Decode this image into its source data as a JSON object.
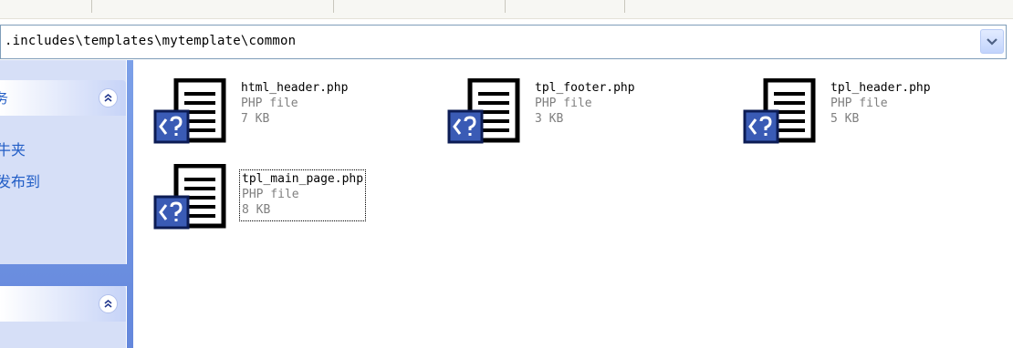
{
  "address_bar": {
    "path": ".includes\\templates\\mytemplate\\common"
  },
  "task_pane": {
    "panel1": {
      "title_fragment": "务",
      "items": [
        "牛夹",
        "发布到"
      ]
    }
  },
  "files": [
    {
      "name": "html_header.php",
      "type": "PHP file",
      "size": "7 KB"
    },
    {
      "name": "tpl_footer.php",
      "type": "PHP file",
      "size": "3 KB"
    },
    {
      "name": "tpl_header.php",
      "type": "PHP file",
      "size": "5 KB"
    },
    {
      "name": "tpl_main_page.php",
      "type": "PHP file",
      "size": "8 KB"
    }
  ],
  "colors": {
    "pane_background": "#6f93e2",
    "panel_body": "#d6dff7",
    "link_text": "#215dc6",
    "icon_badge": "#3a5bb5"
  }
}
